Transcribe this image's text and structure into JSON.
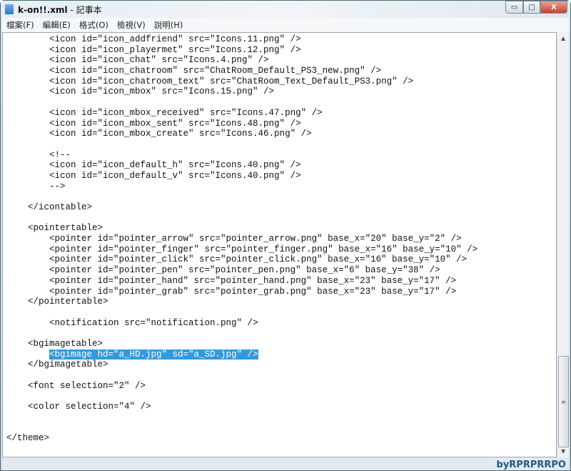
{
  "window": {
    "title": "k-on!!.xml",
    "app": " - 記事本",
    "minimize": "▭",
    "maximize": "□",
    "close": "X"
  },
  "menu": [
    "檔案(F)",
    "編輯(E)",
    "格式(O)",
    "檢視(V)",
    "說明(H)"
  ],
  "editor": {
    "selected_line": 30,
    "lines": [
      "        <icon id=\"icon_addfriend\" src=\"Icons.11.png\" />",
      "        <icon id=\"icon_playermet\" src=\"Icons.12.png\" />",
      "        <icon id=\"icon_chat\" src=\"Icons.4.png\" />",
      "        <icon id=\"icon_chatroom\" src=\"ChatRoom_Default_PS3_new.png\" />",
      "        <icon id=\"icon_chatroom_text\" src=\"ChatRoom_Text_Default_PS3.png\" />",
      "        <icon id=\"icon_mbox\" src=\"Icons.15.png\" />",
      "",
      "        <icon id=\"icon_mbox_received\" src=\"Icons.47.png\" />",
      "        <icon id=\"icon_mbox_sent\" src=\"Icons.48.png\" />",
      "        <icon id=\"icon_mbox_create\" src=\"Icons.46.png\" />",
      "",
      "        <!--",
      "        <icon id=\"icon_default_h\" src=\"Icons.40.png\" />",
      "        <icon id=\"icon_default_v\" src=\"Icons.40.png\" />",
      "        -->",
      "",
      "    </icontable>",
      "",
      "    <pointertable>",
      "        <pointer id=\"pointer_arrow\" src=\"pointer_arrow.png\" base_x=\"20\" base_y=\"2\" />",
      "        <pointer id=\"pointer_finger\" src=\"pointer_finger.png\" base_x=\"16\" base_y=\"10\" />",
      "        <pointer id=\"pointer_click\" src=\"pointer_click.png\" base_x=\"16\" base_y=\"10\" />",
      "        <pointer id=\"pointer_pen\" src=\"pointer_pen.png\" base_x=\"6\" base_y=\"38\" />",
      "        <pointer id=\"pointer_hand\" src=\"pointer_hand.png\" base_x=\"23\" base_y=\"17\" />",
      "        <pointer id=\"pointer_grab\" src=\"pointer_grab.png\" base_x=\"23\" base_y=\"17\" />",
      "    </pointertable>",
      "",
      "        <notification src=\"notification.png\" />",
      "",
      "    <bgimagetable>",
      "        <bgimage hd=\"a_HD.jpg\" sd=\"a_SD.jpg\" />",
      "    </bgimagetable>",
      "",
      "    <font selection=\"2\" />",
      "",
      "    <color selection=\"4\" />",
      "",
      "",
      "</theme>"
    ]
  },
  "scrollbar": {
    "up": "▲",
    "down": "▼",
    "grip": "≡",
    "position": 0.92
  },
  "watermark": "byRPRPRRPO"
}
